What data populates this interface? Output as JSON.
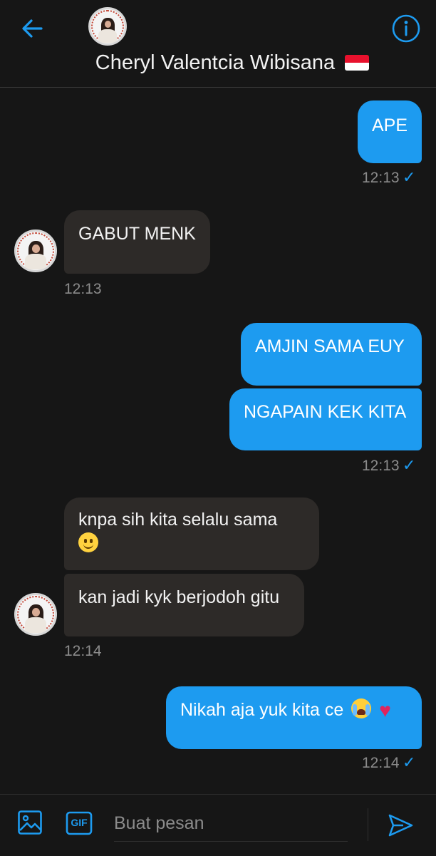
{
  "header": {
    "contact_name": "Cheryl Valentcia Wibisana",
    "flag_icon": "indonesia-flag-icon",
    "back_icon": "arrow-left-icon",
    "info_icon": "info-circle-icon"
  },
  "messages": [
    {
      "side": "out",
      "text": "APE",
      "time": "12:13",
      "status": "sent"
    },
    {
      "side": "in",
      "text": "GABUT MENK",
      "time": "12:13"
    },
    {
      "side": "out",
      "text": "AMJIN SAMA EUY"
    },
    {
      "side": "out",
      "text": "NGAPAIN KEK KITA",
      "time": "12:13",
      "status": "sent"
    },
    {
      "side": "in",
      "text": "knpa sih kita selalu sama",
      "emoji": "slightly-smiling-face"
    },
    {
      "side": "in",
      "text": "kan jadi kyk berjodoh gitu",
      "time": "12:14"
    },
    {
      "side": "out",
      "text": "Nikah aja yuk kita ce",
      "emoji": [
        "loudly-crying-face",
        "red-heart"
      ],
      "time": "12:14",
      "status": "sent"
    }
  ],
  "composer": {
    "placeholder": "Buat pesan",
    "gif_label": "GIF",
    "image_icon": "image-icon",
    "send_icon": "send-icon"
  },
  "colors": {
    "background": "#161616",
    "outgoing_bubble": "#1d9bf0",
    "incoming_bubble": "#2d2a28",
    "accent": "#1d9bf0",
    "timestamp": "#8b8b8b"
  }
}
